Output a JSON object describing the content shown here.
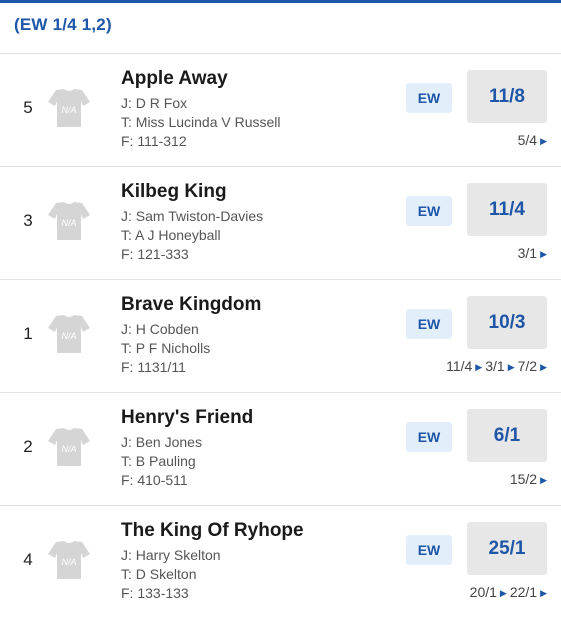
{
  "each_way_terms": "(EW 1/4 1,2)",
  "colors": {
    "accent": "#1e56a8",
    "ew_background": "#e3eefb",
    "odds_background": "#e7e7e7",
    "silk_placeholder": "#d5d5d5"
  },
  "runners": [
    {
      "number": "5",
      "name": "Apple Away",
      "silk_label": "N/A",
      "jockey": "J: D R Fox",
      "trainer": "T: Miss Lucinda V Russell",
      "form": "F: 111-312",
      "ew_label": "EW",
      "odds": "11/8",
      "previous_odds": [
        "5/4"
      ]
    },
    {
      "number": "3",
      "name": "Kilbeg King",
      "silk_label": "N/A",
      "jockey": "J: Sam Twiston-Davies",
      "trainer": "T: A J Honeyball",
      "form": "F: 121-333",
      "ew_label": "EW",
      "odds": "11/4",
      "previous_odds": [
        "3/1"
      ]
    },
    {
      "number": "1",
      "name": "Brave Kingdom",
      "silk_label": "N/A",
      "jockey": "J: H Cobden",
      "trainer": "T: P F Nicholls",
      "form": "F: 1131/11",
      "ew_label": "EW",
      "odds": "10/3",
      "previous_odds": [
        "11/4",
        "3/1",
        "7/2"
      ]
    },
    {
      "number": "2",
      "name": "Henry's Friend",
      "silk_label": "N/A",
      "jockey": "J: Ben Jones",
      "trainer": "T: B Pauling",
      "form": "F: 410-511",
      "ew_label": "EW",
      "odds": "6/1",
      "previous_odds": [
        "15/2"
      ]
    },
    {
      "number": "4",
      "name": "The King Of Ryhope",
      "silk_label": "N/A",
      "jockey": "J: Harry Skelton",
      "trainer": "T: D Skelton",
      "form": "F: 133-133",
      "ew_label": "EW",
      "odds": "25/1",
      "previous_odds": [
        "20/1",
        "22/1"
      ]
    }
  ]
}
